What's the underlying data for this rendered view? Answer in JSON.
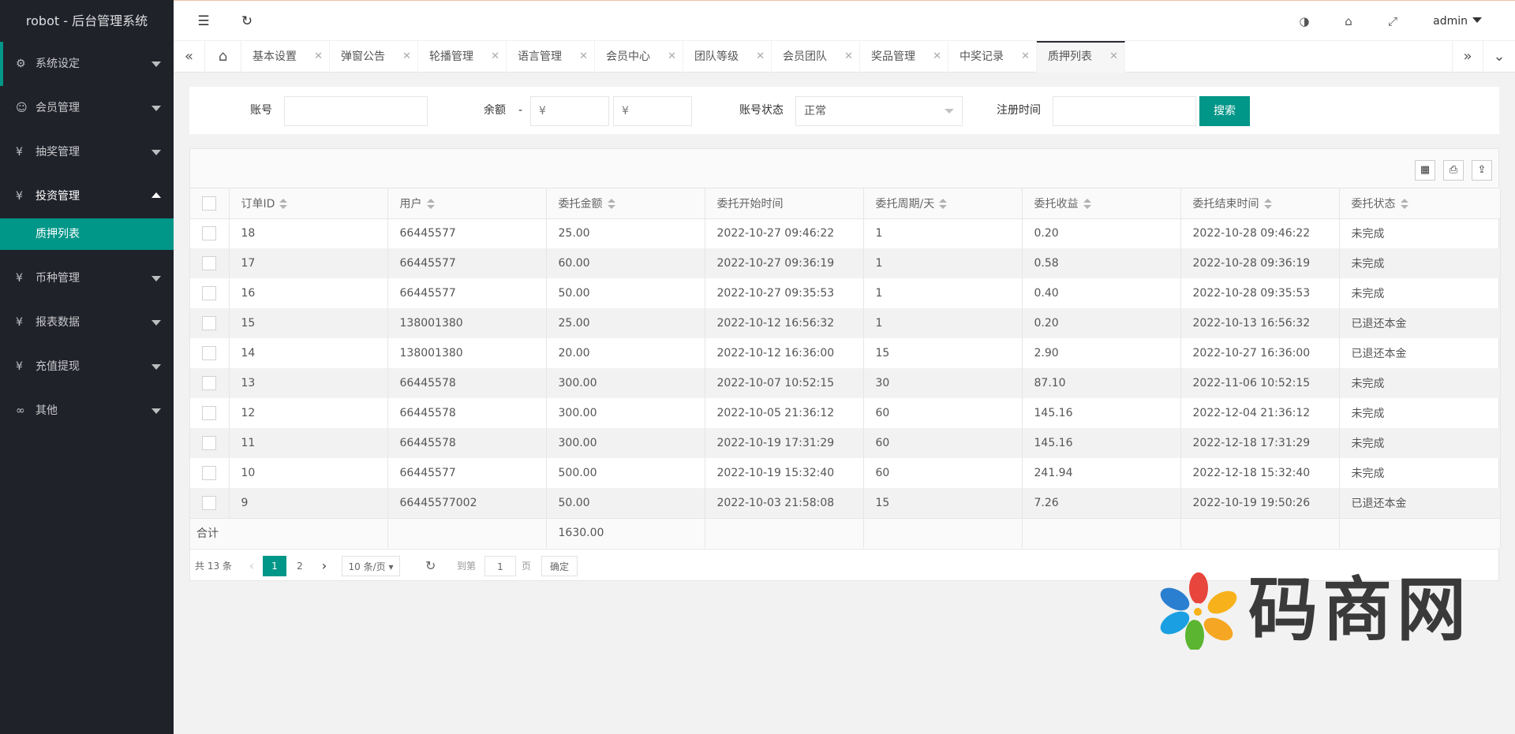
{
  "app": {
    "title": "robot - 后台管理系统"
  },
  "sidebar": {
    "items": [
      {
        "label": "系统设定",
        "icon": "gear-icon",
        "glyph": "⚙"
      },
      {
        "label": "会员管理",
        "icon": "user-icon",
        "glyph": "☺"
      },
      {
        "label": "抽奖管理",
        "icon": "yen-icon",
        "glyph": "¥"
      },
      {
        "label": "投资管理",
        "icon": "yen-icon",
        "glyph": "¥"
      },
      {
        "label": "币种管理",
        "icon": "yen-icon",
        "glyph": "¥"
      },
      {
        "label": "报表数据",
        "icon": "yen-icon",
        "glyph": "¥"
      },
      {
        "label": "充值提现",
        "icon": "yen-icon",
        "glyph": "¥"
      },
      {
        "label": "其他",
        "icon": "infinity-icon",
        "glyph": "∞"
      }
    ],
    "active_sub": "质押列表"
  },
  "header": {
    "user": "admin"
  },
  "tabs": [
    "基本设置",
    "弹窗公告",
    "轮播管理",
    "语言管理",
    "会员中心",
    "团队等级",
    "会员团队",
    "奖品管理",
    "中奖记录",
    "质押列表"
  ],
  "filters": {
    "account_label": "账号",
    "balance_label": "余额",
    "dash": "-",
    "min_placeholder": "¥",
    "max_placeholder": "¥",
    "status_label": "账号状态",
    "status_value": "正常",
    "reg_label": "注册时间",
    "search_btn": "搜索"
  },
  "table": {
    "columns": [
      "订单ID",
      "用户",
      "委托金额",
      "委托开始时间",
      "委托周期/天",
      "委托收益",
      "委托结束时间",
      "委托状态"
    ],
    "rows": [
      [
        "18",
        "66445577",
        "25.00",
        "2022-10-27 09:46:22",
        "1",
        "0.20",
        "2022-10-28 09:46:22",
        "未完成"
      ],
      [
        "17",
        "66445577",
        "60.00",
        "2022-10-27 09:36:19",
        "1",
        "0.58",
        "2022-10-28 09:36:19",
        "未完成"
      ],
      [
        "16",
        "66445577",
        "50.00",
        "2022-10-27 09:35:53",
        "1",
        "0.40",
        "2022-10-28 09:35:53",
        "未完成"
      ],
      [
        "15",
        "138001380",
        "25.00",
        "2022-10-12 16:56:32",
        "1",
        "0.20",
        "2022-10-13 16:56:32",
        "已退还本金"
      ],
      [
        "14",
        "138001380",
        "20.00",
        "2022-10-12 16:36:00",
        "15",
        "2.90",
        "2022-10-27 16:36:00",
        "已退还本金"
      ],
      [
        "13",
        "66445578",
        "300.00",
        "2022-10-07 10:52:15",
        "30",
        "87.10",
        "2022-11-06 10:52:15",
        "未完成"
      ],
      [
        "12",
        "66445578",
        "300.00",
        "2022-10-05 21:36:12",
        "60",
        "145.16",
        "2022-12-04 21:36:12",
        "未完成"
      ],
      [
        "11",
        "66445578",
        "300.00",
        "2022-10-19 17:31:29",
        "60",
        "145.16",
        "2022-12-18 17:31:29",
        "未完成"
      ],
      [
        "10",
        "66445577",
        "500.00",
        "2022-10-19 15:32:40",
        "60",
        "241.94",
        "2022-12-18 15:32:40",
        "未完成"
      ],
      [
        "9",
        "66445577002",
        "50.00",
        "2022-10-03 21:58:08",
        "15",
        "7.26",
        "2022-10-19 19:50:26",
        "已退还本金"
      ]
    ],
    "total_label": "合计",
    "total_amount": "1630.00"
  },
  "pager": {
    "total": "共 13 条",
    "prev": "‹",
    "next": "›",
    "page1": "1",
    "page2": "2",
    "per_page": "10 条/页",
    "goto_label": "到第",
    "goto_value": "1",
    "page_unit": "页",
    "confirm": "确定"
  },
  "watermark": {
    "text": "码商网"
  },
  "colors": {
    "accent": "#009688",
    "sidebar": "#20222a"
  }
}
